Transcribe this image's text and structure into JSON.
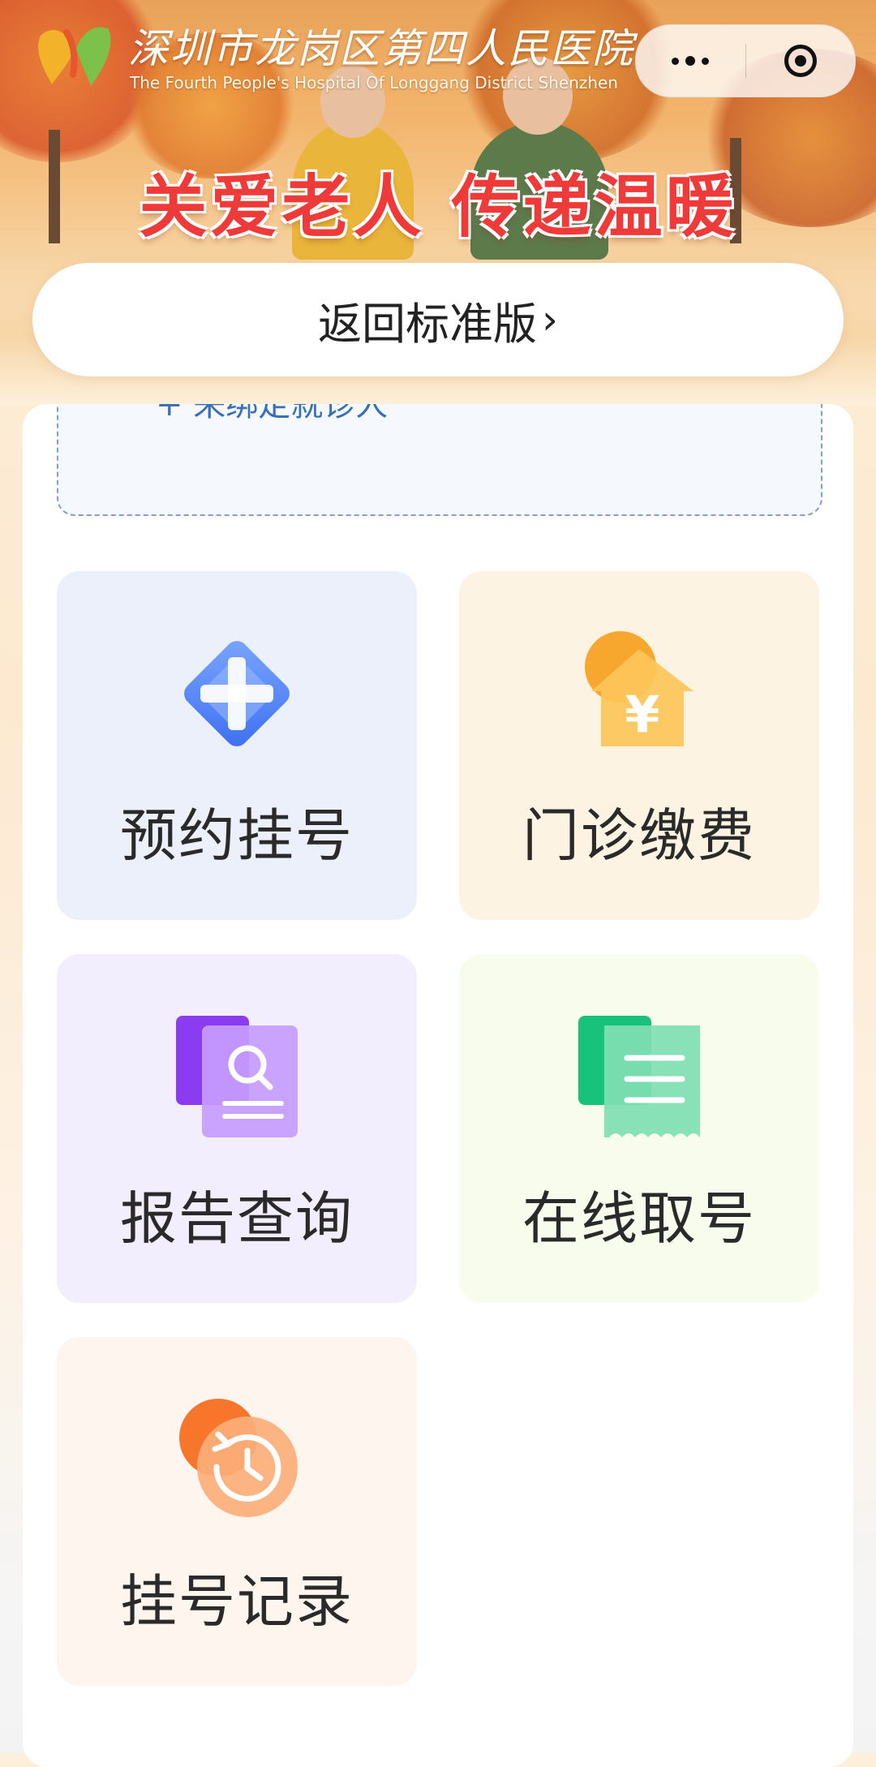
{
  "header": {
    "hospital_name": "深圳市龙岗区第四人民医院",
    "hospital_name_en": "The Fourth People's Hospital Of Longgang District Shenzhen",
    "slogan": "关爱老人 传递温暖"
  },
  "capsule": {
    "more_icon": "more-dots-icon",
    "close_icon": "target-circle-icon"
  },
  "return_button": {
    "label": "返回标准版",
    "chevron": "›"
  },
  "patient": {
    "text": "+ 来绑定就诊人"
  },
  "services": [
    {
      "label": "预约挂号",
      "icon": "medical-cross-icon",
      "color": "#4d7ff0"
    },
    {
      "label": "门诊缴费",
      "icon": "yuan-house-icon",
      "color": "#f7a934"
    },
    {
      "label": "报告查询",
      "icon": "report-search-icon",
      "color": "#9d5cf0"
    },
    {
      "label": "在线取号",
      "icon": "receipt-icon",
      "color": "#22c27a"
    },
    {
      "label": "挂号记录",
      "icon": "history-clock-icon",
      "color": "#f7792f"
    }
  ]
}
